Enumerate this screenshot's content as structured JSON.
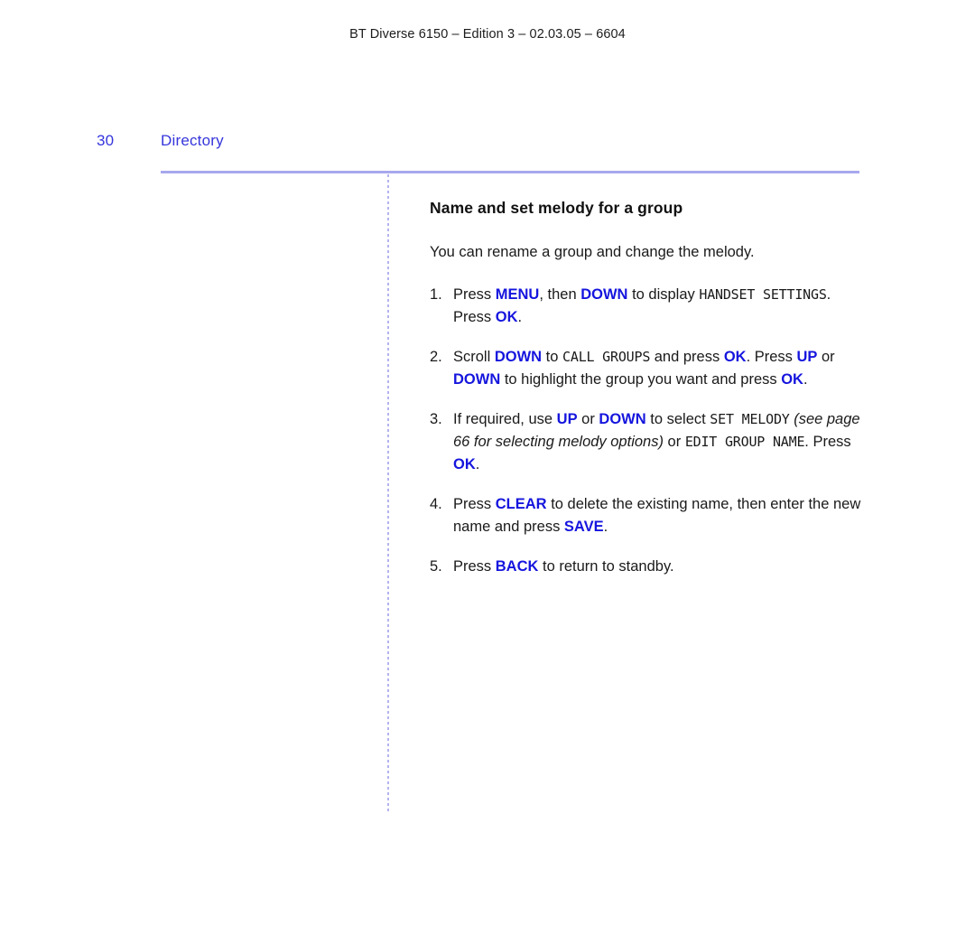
{
  "header": {
    "running_head": "BT Diverse 6150 – Edition 3 – 02.03.05 – 6604"
  },
  "folio": {
    "page_number": "30",
    "section": "Directory"
  },
  "colors": {
    "key_blue": "#1515de",
    "heading_blue": "#3535dc",
    "rule_blue": "#a8a8ee",
    "body_text": "#1a1a1a"
  },
  "main": {
    "heading": "Name and set melody for a group",
    "intro": "You can rename a group and change the melody.",
    "steps": [
      {
        "number": "1.",
        "runs": [
          {
            "text": "Press ",
            "style": "normal"
          },
          {
            "text": "MENU",
            "style": "key"
          },
          {
            "text": ", then ",
            "style": "normal"
          },
          {
            "text": "DOWN",
            "style": "key"
          },
          {
            "text": " to display ",
            "style": "normal"
          },
          {
            "text": "HANDSET SETTINGS",
            "style": "lcd"
          },
          {
            "text": ". Press ",
            "style": "normal"
          },
          {
            "text": "OK",
            "style": "key"
          },
          {
            "text": ".",
            "style": "normal"
          }
        ]
      },
      {
        "number": "2.",
        "runs": [
          {
            "text": "Scroll ",
            "style": "normal"
          },
          {
            "text": "DOWN",
            "style": "key"
          },
          {
            "text": " to ",
            "style": "normal"
          },
          {
            "text": "CALL GROUPS",
            "style": "lcd"
          },
          {
            "text": " and press ",
            "style": "normal"
          },
          {
            "text": "OK",
            "style": "key"
          },
          {
            "text": ". Press ",
            "style": "normal"
          },
          {
            "text": "UP",
            "style": "key"
          },
          {
            "text": " or ",
            "style": "normal"
          },
          {
            "text": "DOWN",
            "style": "key"
          },
          {
            "text": " to highlight the group you want and press ",
            "style": "normal"
          },
          {
            "text": "OK",
            "style": "key"
          },
          {
            "text": ".",
            "style": "normal"
          }
        ]
      },
      {
        "number": "3.",
        "runs": [
          {
            "text": "If required, use ",
            "style": "normal"
          },
          {
            "text": "UP",
            "style": "key"
          },
          {
            "text": " or ",
            "style": "normal"
          },
          {
            "text": "DOWN",
            "style": "key"
          },
          {
            "text": " to select ",
            "style": "normal"
          },
          {
            "text": "SET MELODY",
            "style": "lcd"
          },
          {
            "text": " ",
            "style": "normal"
          },
          {
            "text": "(see page 66 for selecting melody options)",
            "style": "italic"
          },
          {
            "text": " or ",
            "style": "normal"
          },
          {
            "text": "EDIT GROUP NAME",
            "style": "lcd"
          },
          {
            "text": ". Press ",
            "style": "normal"
          },
          {
            "text": "OK",
            "style": "key"
          },
          {
            "text": ".",
            "style": "normal"
          }
        ]
      },
      {
        "number": "4.",
        "runs": [
          {
            "text": "Press ",
            "style": "normal"
          },
          {
            "text": "CLEAR",
            "style": "key"
          },
          {
            "text": " to delete the existing name, then enter the new name and press ",
            "style": "normal"
          },
          {
            "text": "SAVE",
            "style": "key"
          },
          {
            "text": ".",
            "style": "normal"
          }
        ]
      },
      {
        "number": "5.",
        "runs": [
          {
            "text": "Press ",
            "style": "normal"
          },
          {
            "text": "BACK",
            "style": "key"
          },
          {
            "text": " to return to standby.",
            "style": "normal"
          }
        ]
      }
    ]
  }
}
